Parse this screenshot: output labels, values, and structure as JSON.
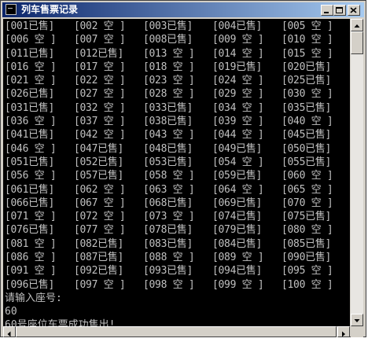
{
  "window": {
    "title": "列车售票记录",
    "controls": {
      "minimize": "minimize-icon",
      "maximize": "maximize-icon",
      "close": "close-icon"
    }
  },
  "console": {
    "seats": [
      "[001已售]",
      "[002 空 ]",
      "[003已售]",
      "[004已售]",
      "[005 空 ]",
      "[006 空 ]",
      "[007 空 ]",
      "[008已售]",
      "[009 空 ]",
      "[010 空 ]",
      "[011已售]",
      "[012已售]",
      "[013 空 ]",
      "[014 空 ]",
      "[015 空 ]",
      "[016 空 ]",
      "[017 空 ]",
      "[018 空 ]",
      "[019已售]",
      "[020已售]",
      "[021 空 ]",
      "[022 空 ]",
      "[023 空 ]",
      "[024 空 ]",
      "[025已售]",
      "[026已售]",
      "[027 空 ]",
      "[028 空 ]",
      "[029 空 ]",
      "[030 空 ]",
      "[031已售]",
      "[032 空 ]",
      "[033已售]",
      "[034 空 ]",
      "[035已售]",
      "[036 空 ]",
      "[037 空 ]",
      "[038已售]",
      "[039 空 ]",
      "[040 空 ]",
      "[041已售]",
      "[042 空 ]",
      "[043 空 ]",
      "[044 空 ]",
      "[045已售]",
      "[046 空 ]",
      "[047已售]",
      "[048已售]",
      "[049已售]",
      "[050已售]",
      "[051已售]",
      "[052已售]",
      "[053已售]",
      "[054 空 ]",
      "[055已售]",
      "[056 空 ]",
      "[057已售]",
      "[058 空 ]",
      "[059已售]",
      "[060 空 ]",
      "[061已售]",
      "[062 空 ]",
      "[063 空 ]",
      "[064 空 ]",
      "[065 空 ]",
      "[066已售]",
      "[067 空 ]",
      "[068已售]",
      "[069已售]",
      "[070 空 ]",
      "[071 空 ]",
      "[072 空 ]",
      "[073 空 ]",
      "[074已售]",
      "[075已售]",
      "[076已售]",
      "[077 空 ]",
      "[078已售]",
      "[079已售]",
      "[080 空 ]",
      "[081 空 ]",
      "[082已售]",
      "[083已售]",
      "[084已售]",
      "[085已售]",
      "[086 空 ]",
      "[087已售]",
      "[088 空 ]",
      "[089 空 ]",
      "[090已售]",
      "[091 空 ]",
      "[092已售]",
      "[093已售]",
      "[094已售]",
      "[095 空 ]",
      "[096已售]",
      "[097 空 ]",
      "[098 空 ]",
      "[099 空 ]",
      "[100 空 ]"
    ],
    "prompt": "请输入座号:",
    "input_value": "60",
    "result": "60号座位车票成功售出!"
  },
  "colors": {
    "console_bg": "#000000",
    "console_text": "#c0c0c0",
    "titlebar_start": "#0a246a",
    "titlebar_end": "#a6caf0"
  }
}
